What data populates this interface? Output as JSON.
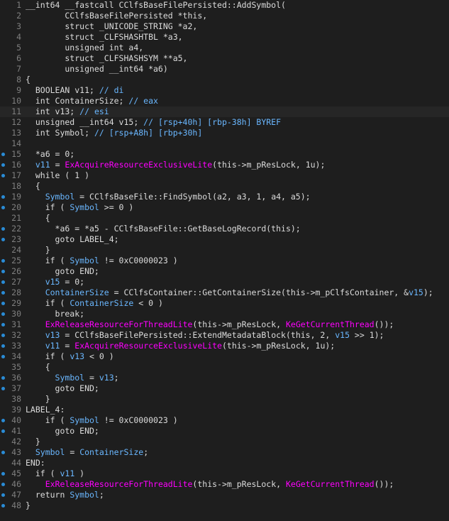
{
  "colors": {
    "background": "#1e1e1e",
    "text": "#dcdcdc",
    "line_number": "#7f7f7f",
    "breakpoint_dot": "#2a8cd6",
    "variable": "#6ab7ff",
    "function": "#ff00ff"
  },
  "lines": [
    {
      "num": "1",
      "dot": false,
      "tokens": [
        {
          "t": "__int64 __fastcall CClfsBaseFilePersisted::AddSymbol(",
          "c": "plain"
        }
      ]
    },
    {
      "num": "2",
      "dot": false,
      "tokens": [
        {
          "t": "        CClfsBaseFilePersisted *this,",
          "c": "plain"
        }
      ]
    },
    {
      "num": "3",
      "dot": false,
      "tokens": [
        {
          "t": "        struct _UNICODE_STRING *a2,",
          "c": "plain"
        }
      ]
    },
    {
      "num": "4",
      "dot": false,
      "tokens": [
        {
          "t": "        struct _CLFSHASHTBL *a3,",
          "c": "plain"
        }
      ]
    },
    {
      "num": "5",
      "dot": false,
      "tokens": [
        {
          "t": "        unsigned int a4,",
          "c": "plain"
        }
      ]
    },
    {
      "num": "6",
      "dot": false,
      "tokens": [
        {
          "t": "        struct _CLFSHASHSYM **a5,",
          "c": "plain"
        }
      ]
    },
    {
      "num": "7",
      "dot": false,
      "tokens": [
        {
          "t": "        unsigned __int64 *a6)",
          "c": "plain"
        }
      ]
    },
    {
      "num": "8",
      "dot": false,
      "tokens": [
        {
          "t": "{",
          "c": "plain"
        }
      ]
    },
    {
      "num": "9",
      "dot": false,
      "tokens": [
        {
          "t": "  BOOLEAN v11; ",
          "c": "plain"
        },
        {
          "t": "// di",
          "c": "cmt"
        }
      ]
    },
    {
      "num": "10",
      "dot": false,
      "tokens": [
        {
          "t": "  int ContainerSize; ",
          "c": "plain"
        },
        {
          "t": "// eax",
          "c": "cmt"
        }
      ]
    },
    {
      "num": "11",
      "dot": false,
      "current": true,
      "tokens": [
        {
          "t": "  int v13; ",
          "c": "plain"
        },
        {
          "t": "// esi",
          "c": "cmt"
        }
      ]
    },
    {
      "num": "12",
      "dot": false,
      "tokens": [
        {
          "t": "  unsigned __int64 v15; ",
          "c": "plain"
        },
        {
          "t": "// [rsp+40h] [rbp-38h] BYREF",
          "c": "cmt"
        }
      ]
    },
    {
      "num": "13",
      "dot": false,
      "tokens": [
        {
          "t": "  int Symbol; ",
          "c": "plain"
        },
        {
          "t": "// [rsp+A8h] [rbp+30h]",
          "c": "cmt"
        }
      ]
    },
    {
      "num": "14",
      "dot": false,
      "tokens": [
        {
          "t": "",
          "c": "plain"
        }
      ]
    },
    {
      "num": "15",
      "dot": true,
      "tokens": [
        {
          "t": "  *a6 = 0;",
          "c": "plain"
        }
      ]
    },
    {
      "num": "16",
      "dot": true,
      "tokens": [
        {
          "t": "  ",
          "c": "plain"
        },
        {
          "t": "v11",
          "c": "var"
        },
        {
          "t": " = ",
          "c": "plain"
        },
        {
          "t": "ExAcquireResourceExclusiveLite",
          "c": "fn"
        },
        {
          "t": "(this->m_pResLock, 1u);",
          "c": "plain"
        }
      ]
    },
    {
      "num": "17",
      "dot": true,
      "tokens": [
        {
          "t": "  while ( 1 )",
          "c": "plain"
        }
      ]
    },
    {
      "num": "18",
      "dot": false,
      "tokens": [
        {
          "t": "  {",
          "c": "plain"
        }
      ]
    },
    {
      "num": "19",
      "dot": true,
      "tokens": [
        {
          "t": "    ",
          "c": "plain"
        },
        {
          "t": "Symbol",
          "c": "var"
        },
        {
          "t": " = CClfsBaseFile::FindSymbol(a2, a3, 1, a4, a5);",
          "c": "plain"
        }
      ]
    },
    {
      "num": "20",
      "dot": true,
      "tokens": [
        {
          "t": "    if ( ",
          "c": "plain"
        },
        {
          "t": "Symbol",
          "c": "var"
        },
        {
          "t": " >= 0 )",
          "c": "plain"
        }
      ]
    },
    {
      "num": "21",
      "dot": false,
      "tokens": [
        {
          "t": "    {",
          "c": "plain"
        }
      ]
    },
    {
      "num": "22",
      "dot": true,
      "tokens": [
        {
          "t": "      *a6 = *a5 - CClfsBaseFile::GetBaseLogRecord(this);",
          "c": "plain"
        }
      ]
    },
    {
      "num": "23",
      "dot": true,
      "tokens": [
        {
          "t": "      goto LABEL_4;",
          "c": "plain"
        }
      ]
    },
    {
      "num": "24",
      "dot": false,
      "tokens": [
        {
          "t": "    }",
          "c": "plain"
        }
      ]
    },
    {
      "num": "25",
      "dot": true,
      "tokens": [
        {
          "t": "    if ( ",
          "c": "plain"
        },
        {
          "t": "Symbol",
          "c": "var"
        },
        {
          "t": " != 0xC0000023 )",
          "c": "plain"
        }
      ]
    },
    {
      "num": "26",
      "dot": true,
      "tokens": [
        {
          "t": "      goto END;",
          "c": "plain"
        }
      ]
    },
    {
      "num": "27",
      "dot": true,
      "tokens": [
        {
          "t": "    ",
          "c": "plain"
        },
        {
          "t": "v15",
          "c": "var"
        },
        {
          "t": " = 0;",
          "c": "plain"
        }
      ]
    },
    {
      "num": "28",
      "dot": true,
      "tokens": [
        {
          "t": "    ",
          "c": "plain"
        },
        {
          "t": "ContainerSize",
          "c": "var"
        },
        {
          "t": " = CClfsContainer::GetContainerSize(this->m_pClfsContainer, &",
          "c": "plain"
        },
        {
          "t": "v15",
          "c": "var"
        },
        {
          "t": ");",
          "c": "plain"
        }
      ]
    },
    {
      "num": "29",
      "dot": true,
      "tokens": [
        {
          "t": "    if ( ",
          "c": "plain"
        },
        {
          "t": "ContainerSize",
          "c": "var"
        },
        {
          "t": " < 0 )",
          "c": "plain"
        }
      ]
    },
    {
      "num": "30",
      "dot": true,
      "tokens": [
        {
          "t": "      break;",
          "c": "plain"
        }
      ]
    },
    {
      "num": "31",
      "dot": true,
      "tokens": [
        {
          "t": "    ",
          "c": "plain"
        },
        {
          "t": "ExReleaseResourceForThreadLite",
          "c": "fn"
        },
        {
          "t": "(this->m_pResLock, ",
          "c": "plain"
        },
        {
          "t": "KeGetCurrentThread",
          "c": "fn"
        },
        {
          "t": "());",
          "c": "plain"
        }
      ]
    },
    {
      "num": "32",
      "dot": true,
      "tokens": [
        {
          "t": "    ",
          "c": "plain"
        },
        {
          "t": "v13",
          "c": "var"
        },
        {
          "t": " = CClfsBaseFilePersisted::ExtendMetadataBlock(this, 2, ",
          "c": "plain"
        },
        {
          "t": "v15",
          "c": "var"
        },
        {
          "t": " >> 1);",
          "c": "plain"
        }
      ]
    },
    {
      "num": "33",
      "dot": true,
      "tokens": [
        {
          "t": "    ",
          "c": "plain"
        },
        {
          "t": "v11",
          "c": "var"
        },
        {
          "t": " = ",
          "c": "plain"
        },
        {
          "t": "ExAcquireResourceExclusiveLite",
          "c": "fn"
        },
        {
          "t": "(this->m_pResLock, 1u);",
          "c": "plain"
        }
      ]
    },
    {
      "num": "34",
      "dot": true,
      "tokens": [
        {
          "t": "    if ( ",
          "c": "plain"
        },
        {
          "t": "v13",
          "c": "var"
        },
        {
          "t": " < 0 )",
          "c": "plain"
        }
      ]
    },
    {
      "num": "35",
      "dot": false,
      "tokens": [
        {
          "t": "    {",
          "c": "plain"
        }
      ]
    },
    {
      "num": "36",
      "dot": true,
      "tokens": [
        {
          "t": "      ",
          "c": "plain"
        },
        {
          "t": "Symbol",
          "c": "var"
        },
        {
          "t": " = ",
          "c": "plain"
        },
        {
          "t": "v13",
          "c": "var"
        },
        {
          "t": ";",
          "c": "plain"
        }
      ]
    },
    {
      "num": "37",
      "dot": true,
      "tokens": [
        {
          "t": "      goto END;",
          "c": "plain"
        }
      ]
    },
    {
      "num": "38",
      "dot": false,
      "tokens": [
        {
          "t": "    }",
          "c": "plain"
        }
      ]
    },
    {
      "num": "39",
      "dot": false,
      "tokens": [
        {
          "t": "LABEL_4:",
          "c": "plain"
        }
      ]
    },
    {
      "num": "40",
      "dot": true,
      "tokens": [
        {
          "t": "    if ( ",
          "c": "plain"
        },
        {
          "t": "Symbol",
          "c": "var"
        },
        {
          "t": " != 0xC0000023 )",
          "c": "plain"
        }
      ]
    },
    {
      "num": "41",
      "dot": true,
      "tokens": [
        {
          "t": "      goto END;",
          "c": "plain"
        }
      ]
    },
    {
      "num": "42",
      "dot": false,
      "tokens": [
        {
          "t": "  }",
          "c": "plain"
        }
      ]
    },
    {
      "num": "43",
      "dot": true,
      "tokens": [
        {
          "t": "  ",
          "c": "plain"
        },
        {
          "t": "Symbol",
          "c": "var"
        },
        {
          "t": " = ",
          "c": "plain"
        },
        {
          "t": "ContainerSize",
          "c": "var"
        },
        {
          "t": ";",
          "c": "plain"
        }
      ]
    },
    {
      "num": "44",
      "dot": false,
      "tokens": [
        {
          "t": "END:",
          "c": "plain"
        }
      ]
    },
    {
      "num": "45",
      "dot": true,
      "tokens": [
        {
          "t": "  if ( ",
          "c": "plain"
        },
        {
          "t": "v11",
          "c": "var"
        },
        {
          "t": " )",
          "c": "plain"
        }
      ]
    },
    {
      "num": "46",
      "dot": true,
      "tokens": [
        {
          "t": "    ",
          "c": "plain"
        },
        {
          "t": "ExReleaseResourceForThreadLite",
          "c": "fn"
        },
        {
          "t": "(this->m_pResLock, ",
          "c": "plain"
        },
        {
          "t": "KeGetCurrentThread",
          "c": "fn"
        },
        {
          "t": "());",
          "c": "plain"
        }
      ]
    },
    {
      "num": "47",
      "dot": true,
      "tokens": [
        {
          "t": "  return ",
          "c": "plain"
        },
        {
          "t": "Symbol",
          "c": "var"
        },
        {
          "t": ";",
          "c": "plain"
        }
      ]
    },
    {
      "num": "48",
      "dot": true,
      "tokens": [
        {
          "t": "}",
          "c": "plain"
        }
      ]
    }
  ]
}
